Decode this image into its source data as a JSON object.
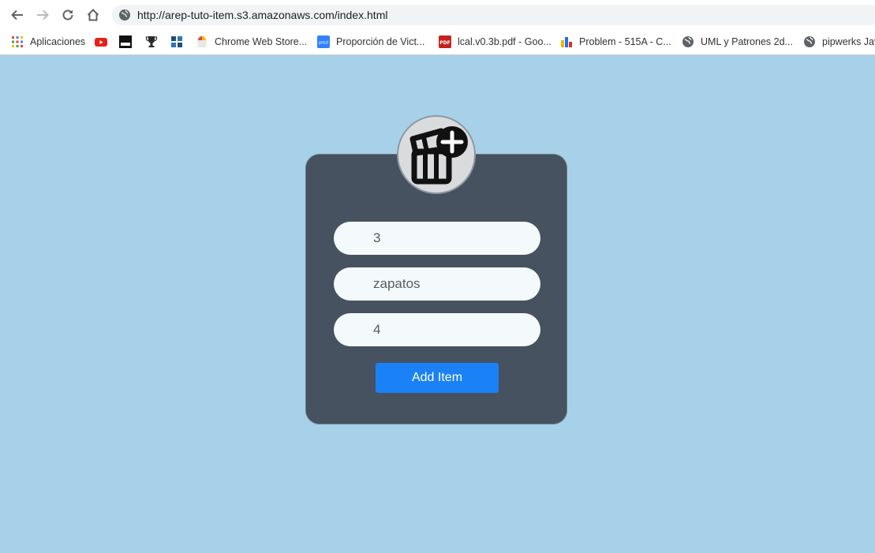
{
  "browser": {
    "url": "http://arep-tuto-item.s3.amazonaws.com/index.html",
    "bookmarks": [
      {
        "label": "Aplicaciones",
        "icon": "apps-grid-icon"
      },
      {
        "label": "",
        "icon": "youtube-icon"
      },
      {
        "label": "",
        "icon": "skill-icon"
      },
      {
        "label": "",
        "icon": "trophy-icon"
      },
      {
        "label": "",
        "icon": "hackerrank-icon"
      },
      {
        "label": "Chrome Web Store...",
        "icon": "chrome-web-store-icon"
      },
      {
        "label": "Proporción de Vict...",
        "icon": "prezi-icon"
      },
      {
        "label": "lcal.v0.3b.pdf - Goo...",
        "icon": "pdf-icon"
      },
      {
        "label": "Problem - 515A - C...",
        "icon": "codeforces-icon"
      },
      {
        "label": "UML y Patrones 2d...",
        "icon": "globe-icon"
      },
      {
        "label": "pipwerks Jav",
        "icon": "globe-icon"
      }
    ]
  },
  "form": {
    "avatar_icon": "gift-add-icon",
    "fields": [
      {
        "value": "3"
      },
      {
        "value": "zapatos"
      },
      {
        "value": "4"
      }
    ],
    "submit_label": "Add Item"
  },
  "colors": {
    "page_background": "#a6d1e8",
    "card_background": "#46525f",
    "button": "#1a82f6"
  }
}
